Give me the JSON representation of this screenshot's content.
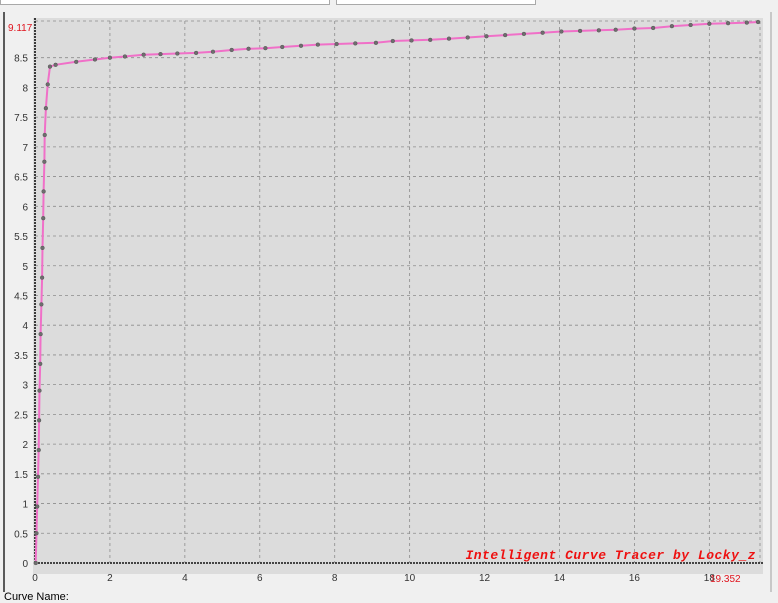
{
  "app": {
    "watermark": "Intelligent Curve Tracer by Locky_z",
    "curve_name_label": "Curve Name:"
  },
  "colors": {
    "plot_bg": "#dcdcdc",
    "grid": "#8c8c8c",
    "curve": "#f070c8",
    "points": "#6e6e6e",
    "extreme_text": "#e0141e",
    "watermark": "#ee1010"
  },
  "chart_data": {
    "type": "line",
    "xlim": [
      0,
      19.352
    ],
    "ylim": [
      0,
      9.117
    ],
    "x_max_label": "19.352",
    "y_max_label": "9.117",
    "x_ticks": [
      0,
      2,
      4,
      6,
      8,
      10,
      12,
      14,
      16,
      18
    ],
    "y_ticks": [
      0,
      0.5,
      1,
      1.5,
      2,
      2.5,
      3,
      3.5,
      4,
      4.5,
      5,
      5.5,
      6,
      6.5,
      7,
      7.5,
      8,
      8.5
    ],
    "grid": true,
    "series": [
      {
        "x": [
          0.02,
          0.04,
          0.06,
          0.08,
          0.1,
          0.11,
          0.12,
          0.14,
          0.15,
          0.17,
          0.19,
          0.2,
          0.22,
          0.23,
          0.25,
          0.26,
          0.29,
          0.34,
          0.4,
          0.55,
          1.1,
          1.6,
          2.0,
          2.4,
          2.9,
          3.35,
          3.8,
          4.3,
          4.75,
          5.25,
          5.7,
          6.15,
          6.6,
          7.1,
          7.55,
          8.05,
          8.55,
          9.1,
          9.55,
          10.05,
          10.55,
          11.05,
          11.55,
          12.05,
          12.55,
          13.05,
          13.55,
          14.05,
          14.55,
          15.05,
          15.5,
          16.0,
          16.5,
          17.0,
          17.5,
          18.0,
          18.5,
          19.0,
          19.3
        ],
        "y": [
          0.0,
          0.5,
          0.95,
          1.45,
          1.9,
          2.4,
          2.9,
          3.35,
          3.85,
          4.35,
          4.8,
          5.3,
          5.8,
          6.25,
          6.75,
          7.2,
          7.65,
          8.05,
          8.35,
          8.38,
          8.43,
          8.47,
          8.5,
          8.52,
          8.55,
          8.56,
          8.57,
          8.58,
          8.6,
          8.63,
          8.65,
          8.66,
          8.68,
          8.7,
          8.72,
          8.73,
          8.74,
          8.75,
          8.78,
          8.79,
          8.8,
          8.82,
          8.84,
          8.86,
          8.88,
          8.9,
          8.92,
          8.94,
          8.95,
          8.96,
          8.97,
          8.99,
          9.0,
          9.03,
          9.05,
          9.07,
          9.08,
          9.09,
          9.1
        ]
      }
    ]
  }
}
